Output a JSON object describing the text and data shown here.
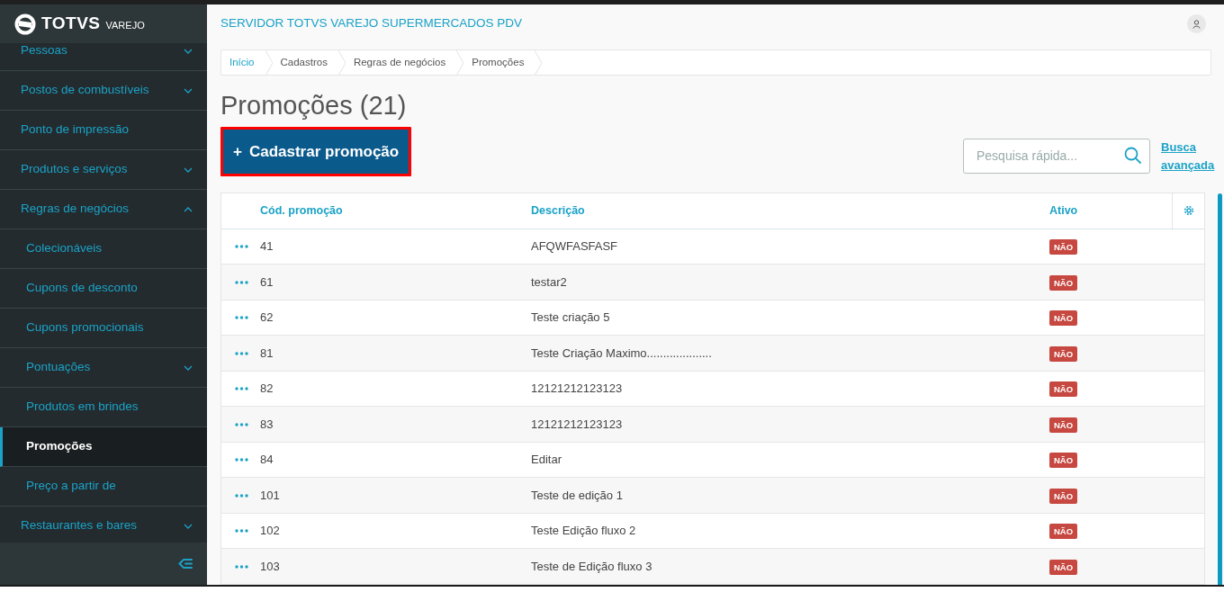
{
  "brand": {
    "name": "TOTVS",
    "product": "VAREJO"
  },
  "sidebar": {
    "items": [
      {
        "label": "Pessoas",
        "kind": "group",
        "expanded": false,
        "selected": false
      },
      {
        "label": "Postos de combustíveis",
        "kind": "group",
        "expanded": false,
        "selected": false
      },
      {
        "label": "Ponto de impressão",
        "kind": "link",
        "selected": false
      },
      {
        "label": "Produtos e serviços",
        "kind": "group",
        "expanded": false,
        "selected": false
      },
      {
        "label": "Regras de negócios",
        "kind": "group",
        "expanded": true,
        "selected": false,
        "children": [
          {
            "label": "Colecionáveis",
            "selected": false
          },
          {
            "label": "Cupons de desconto",
            "selected": false
          },
          {
            "label": "Cupons promocionais",
            "selected": false
          },
          {
            "label": "Pontuações",
            "kind": "group",
            "expanded": false,
            "selected": false
          },
          {
            "label": "Produtos em brindes",
            "selected": false
          },
          {
            "label": "Promoções",
            "selected": true
          },
          {
            "label": "Preço a partir de",
            "selected": false
          }
        ]
      },
      {
        "label": "Restaurantes e bares",
        "kind": "group",
        "expanded": false,
        "selected": false
      }
    ]
  },
  "header": {
    "title": "SERVIDOR TOTVS VAREJO SUPERMERCADOS PDV"
  },
  "breadcrumb": [
    {
      "label": "Início",
      "link": true
    },
    {
      "label": "Cadastros",
      "link": false
    },
    {
      "label": "Regras de negócios",
      "link": false
    },
    {
      "label": "Promoções",
      "link": false
    }
  ],
  "page_title": "Promoções (21)",
  "primary_button": {
    "icon": "+",
    "label": "Cadastrar promoção",
    "highlighted": true
  },
  "search": {
    "placeholder": "Pesquisa rápida..."
  },
  "advanced_search": "Busca avançada",
  "table": {
    "columns": [
      "Cód. promoção",
      "Descrição",
      "Ativo"
    ],
    "rows": [
      {
        "code": "41",
        "description": "AFQWFASFASF",
        "active": "NÃO"
      },
      {
        "code": "61",
        "description": "testar2",
        "active": "NÃO"
      },
      {
        "code": "62",
        "description": "Teste criação 5",
        "active": "NÃO"
      },
      {
        "code": "81",
        "description": "Teste Criação Maximo....................",
        "active": "NÃO"
      },
      {
        "code": "82",
        "description": "12121212123123",
        "active": "NÃO"
      },
      {
        "code": "83",
        "description": "12121212123123",
        "active": "NÃO"
      },
      {
        "code": "84",
        "description": "Editar",
        "active": "NÃO"
      },
      {
        "code": "101",
        "description": "Teste de edição 1",
        "active": "NÃO"
      },
      {
        "code": "102",
        "description": "Teste Edição fluxo 2",
        "active": "NÃO"
      },
      {
        "code": "103",
        "description": "Teste de Edição fluxo 3",
        "active": "NÃO"
      }
    ]
  }
}
